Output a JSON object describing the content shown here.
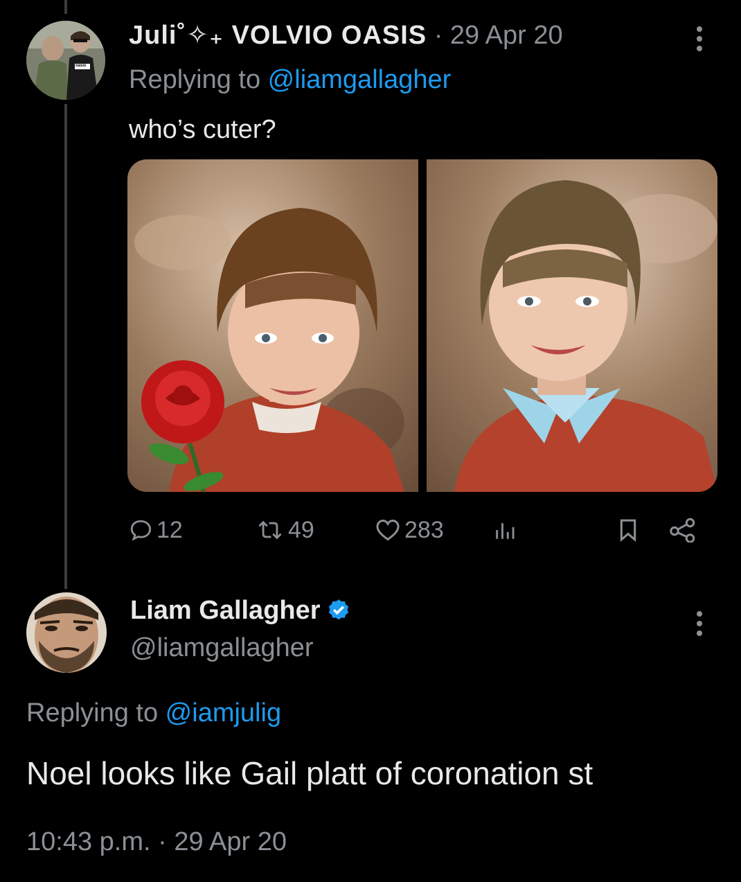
{
  "first_tweet": {
    "display_name": "Juli˚✧₊ VOLVIO OASIS",
    "separator": "·",
    "date": "29 Apr 20",
    "replying_prefix": "Replying to ",
    "replying_to": "@liamgallagher",
    "text": "who’s cuter?",
    "avatar_text": "oasis",
    "stats": {
      "replies": "12",
      "retweets": "49",
      "likes": "283"
    }
  },
  "reply_tweet": {
    "display_name": "Liam Gallagher",
    "handle": "@liamgallagher",
    "verified": true,
    "replying_prefix": "Replying to ",
    "replying_to": "@iamjulig",
    "text": "Noel looks like Gail platt of coronation st",
    "timestamp": "10:43 p.m. · 29 Apr 20"
  },
  "colors": {
    "background": "#000000",
    "text": "#e7e9ea",
    "muted": "#8b9095",
    "accent": "#1d9bf0",
    "thread_line": "#3a3d40"
  },
  "icons": {
    "reply": "reply-icon",
    "retweet": "retweet-icon",
    "like": "heart-icon",
    "views": "views-icon",
    "bookmark": "bookmark-icon",
    "share": "share-icon",
    "more": "more-icon",
    "verified": "verified-badge-icon"
  }
}
